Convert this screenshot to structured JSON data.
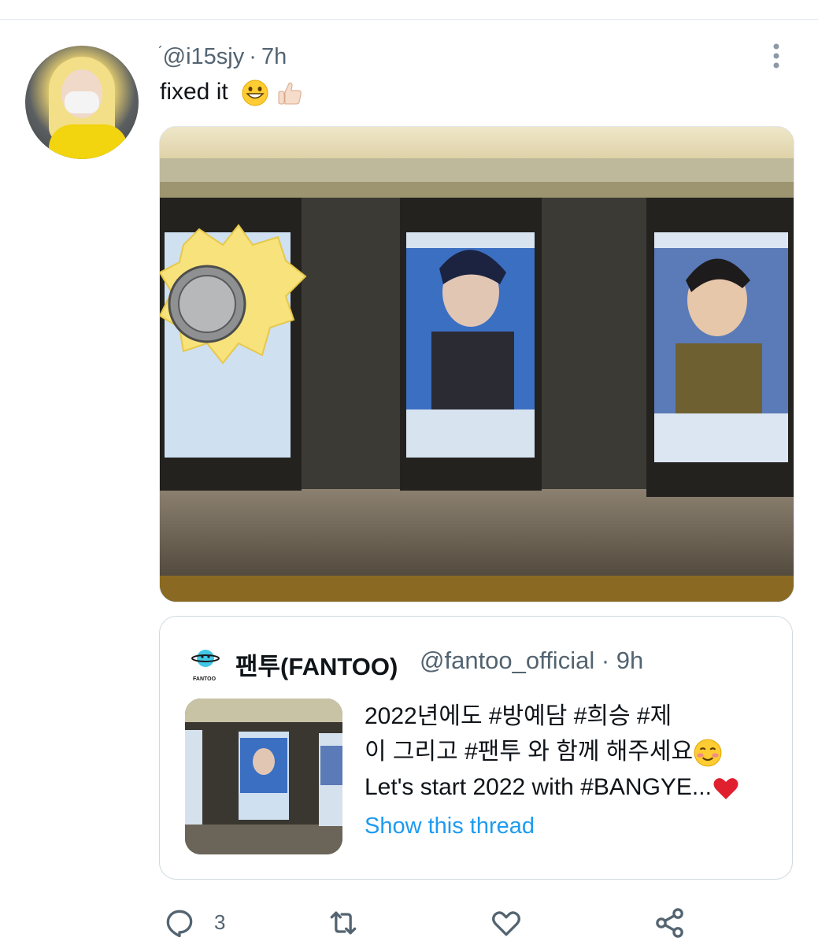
{
  "tweet": {
    "handle": "@i15sjy",
    "separator": "·",
    "time": "7h",
    "text": "fixed it",
    "emojis": [
      "grinning-face",
      "thumbs-up-light-skin"
    ]
  },
  "quote": {
    "name": "팬투(FANTOO)",
    "handle": "@fantoo_official",
    "separator": "·",
    "time": "9h",
    "logo_caption": "FANTOO",
    "lines": [
      "2022년에도 #방예담 #희승 #제",
      "이 그리고 #팬투 와 함께 해주세요",
      "Let's start 2022 with #BANGYE..."
    ],
    "show_thread": "Show this thread"
  },
  "actions": {
    "reply_count": "3",
    "icons": [
      "reply-icon",
      "retweet-icon",
      "like-icon",
      "share-icon"
    ]
  },
  "colors": {
    "text": "#0f1419",
    "secondary": "#536471",
    "link": "#1d9bf0",
    "border": "#cfd9de"
  }
}
